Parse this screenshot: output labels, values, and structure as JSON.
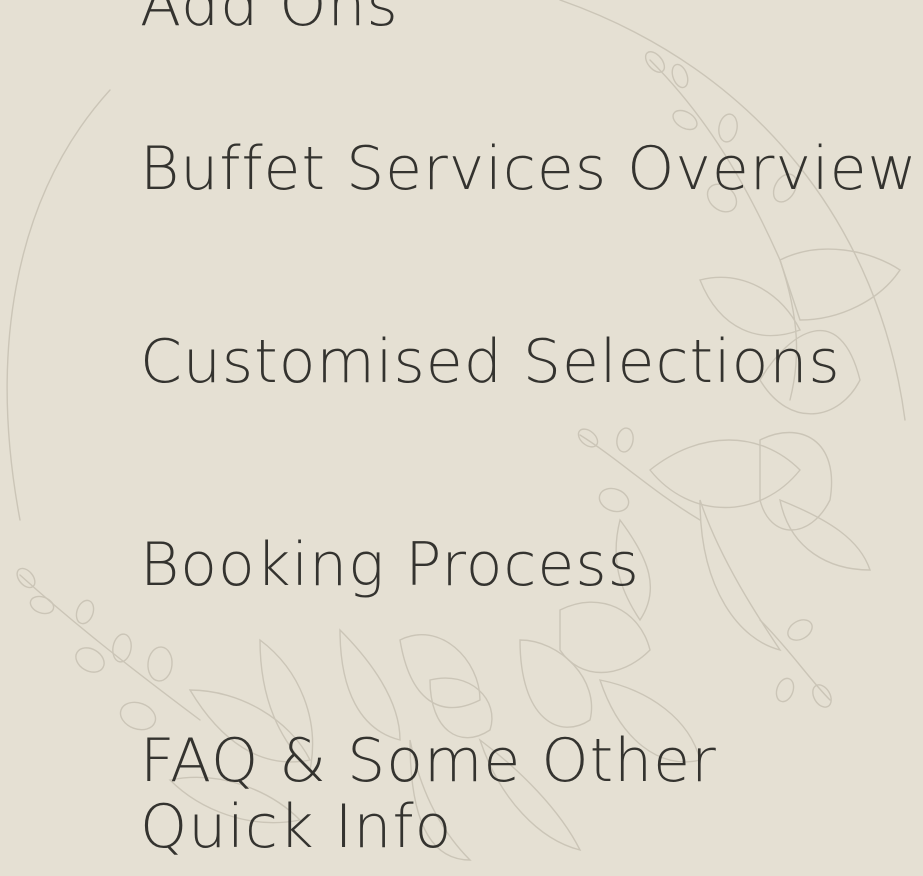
{
  "menu": {
    "items": [
      {
        "label": "Add Ons"
      },
      {
        "label": "Buffet Services Overview"
      },
      {
        "label": "Customised Selections"
      },
      {
        "label": "Booking Process"
      },
      {
        "label": "FAQ & Some Other Quick Info"
      }
    ]
  },
  "decoration": {
    "icon": "floral-wreath-illustration"
  },
  "colors": {
    "background": "#e5e0d3",
    "text": "#34332f",
    "line_art": "#c9c3b5"
  }
}
